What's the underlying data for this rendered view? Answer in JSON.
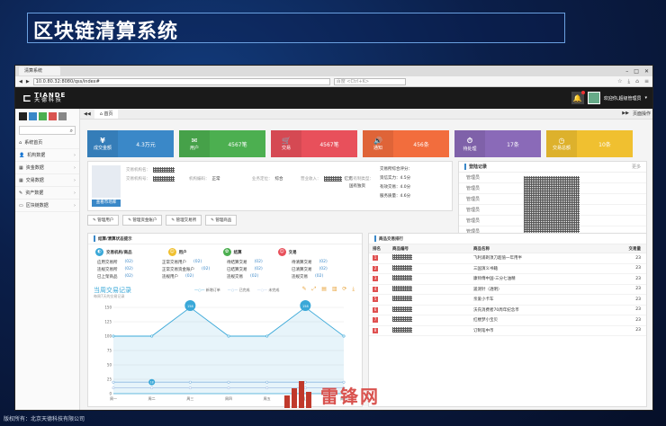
{
  "slide": {
    "title": "区块链清算系统",
    "footer": "版权所有：北京天德科技有限公司",
    "watermark": "雷锋网"
  },
  "browser": {
    "tab_title": "清算系统",
    "url": "10.0.80.32:8080/qss/index#",
    "search_placeholder": "百度 <Ctrl+K>"
  },
  "app": {
    "logo_main": "TIANDE",
    "logo_sub": "天 德 科 技",
    "user_label": "欢迎你,超级管理员",
    "notif_count": "1"
  },
  "sidebar": {
    "colors": [
      "#222222",
      "#3a88c8",
      "#4caf50",
      "#d9534f",
      "#888888"
    ],
    "items": [
      {
        "label": "系统首页"
      },
      {
        "label": "机构数据"
      },
      {
        "label": "资金数据"
      },
      {
        "label": "交易数据"
      },
      {
        "label": "资产数据"
      },
      {
        "label": "区块链数据"
      }
    ]
  },
  "crumbs": {
    "home": "首页",
    "page_ops": "页面操作"
  },
  "stats": [
    {
      "label": "成交金额",
      "value": "4.3万元",
      "color": "#3a88c8",
      "icon": "¥"
    },
    {
      "label": "用户",
      "value": "4567笔",
      "color": "#4caf50",
      "icon": "✉"
    },
    {
      "label": "交易",
      "value": "4567笔",
      "color": "#e8505b",
      "icon": "🛒"
    },
    {
      "label": "通知",
      "value": "456条",
      "color": "#f26d3d",
      "icon": "🔊"
    },
    {
      "label": "待处理",
      "value": "17条",
      "color": "#8a6ab8",
      "icon": "⏱"
    },
    {
      "label": "交易总额",
      "value": "10条",
      "color": "#f0c030",
      "icon": "◷"
    }
  ],
  "info": {
    "view_button": "查看市场库",
    "fields": [
      {
        "k": "交易机构名：",
        "v": ""
      },
      {
        "k": "交易机构号：",
        "v": ""
      },
      {
        "k": "机构编码：",
        "v": "正常"
      },
      {
        "k": "业务定位：",
        "v": "综合"
      },
      {
        "k": "营业收入：",
        "v": "亿元"
      },
      {
        "k": "所有制类型：",
        "v": "国有独资"
      }
    ],
    "right": [
      {
        "k": "交易所综合评分：",
        "v": ""
      },
      {
        "k": "资信实力：",
        "v": "4.5分"
      },
      {
        "k": "有效交易：",
        "v": "4.0分"
      },
      {
        "k": "服务质量：",
        "v": "4.6分"
      }
    ]
  },
  "buttons": [
    "管理用户",
    "管理资金账户",
    "管理交易所",
    "管理商品"
  ],
  "login": {
    "title": "登陆记录",
    "more": "更多",
    "rows": [
      "管理员",
      "管理员",
      "管理员",
      "管理员",
      "管理员",
      "管理员"
    ]
  },
  "settle": {
    "title": "结算/清算状态提示",
    "heads": [
      {
        "label": "交易机构/商品",
        "color": "#3aa8d8",
        "icon": "◐"
      },
      {
        "label": "用户",
        "color": "#f0c030",
        "icon": "☺"
      },
      {
        "label": "结算",
        "color": "#4caf50",
        "icon": "✿"
      },
      {
        "label": "交易",
        "color": "#e8505b",
        "icon": "☺"
      }
    ],
    "grid": [
      {
        "k": "应用交易所",
        "v": "(02)"
      },
      {
        "k": "正常交易用户",
        "v": "(02)"
      },
      {
        "k": "待结算交易",
        "v": "(02)"
      },
      {
        "k": "待清算交易",
        "v": "(02)"
      },
      {
        "k": "违规交易所",
        "v": "(02)"
      },
      {
        "k": "正常交易资金账户",
        "v": "(02)"
      },
      {
        "k": "已结算交易",
        "v": "(02)"
      },
      {
        "k": "已清算交易",
        "v": "(02)"
      },
      {
        "k": "已上架商品",
        "v": "(02)"
      },
      {
        "k": "违规用户",
        "v": "(02)"
      },
      {
        "k": "违规交易",
        "v": "(02)"
      },
      {
        "k": "违规交易",
        "v": "(02)"
      }
    ]
  },
  "week_chart": {
    "title": "当周交易记录",
    "subtitle": "每周7天的交易记录",
    "legend": [
      "新增订单",
      "已完成",
      "未完成"
    ],
    "tools": "✎ ⤢ ▤ ▥ ⟳ ⤓",
    "max_label": "158"
  },
  "chart_data": {
    "type": "line",
    "categories": [
      "周一",
      "周二",
      "周三",
      "周四",
      "周五",
      "周六",
      "周日"
    ],
    "series": [
      {
        "name": "新增订单",
        "values": [
          100,
          100,
          158,
          100,
          100,
          158,
          100
        ]
      },
      {
        "name": "已完成",
        "values": [
          20,
          20,
          20,
          20,
          20,
          20,
          20
        ]
      },
      {
        "name": "未完成",
        "values": [
          10,
          10,
          10,
          10,
          10,
          10,
          10
        ]
      }
    ],
    "ylim": [
      0,
      150
    ],
    "yticks": [
      "150",
      "125",
      "100",
      "75",
      "50",
      "25",
      "0"
    ],
    "point_labels": {
      "peak": "158",
      "low": "18"
    }
  },
  "rank": {
    "title": "商品交易排行",
    "headers": [
      "排名",
      "商品编号",
      "商品名称",
      "交易量"
    ],
    "rows": [
      {
        "n": "1",
        "name": "飞利浦剃须刀超值一年用半",
        "qty": "23"
      },
      {
        "n": "2",
        "name": "三国演义书籍",
        "qty": "23"
      },
      {
        "n": "3",
        "name": "康师傅中国-三分七油精",
        "qty": "23"
      },
      {
        "n": "4",
        "name": "遥测针（透明）",
        "qty": "23"
      },
      {
        "n": "5",
        "name": "亲爱小卡车",
        "qty": "23"
      },
      {
        "n": "6",
        "name": "沃氏消费者70周年纪念币",
        "qty": "23"
      },
      {
        "n": "7",
        "name": "红楼梦小宝贝",
        "qty": "23"
      },
      {
        "n": "8",
        "name": "订制笔中币",
        "qty": "23"
      }
    ]
  }
}
